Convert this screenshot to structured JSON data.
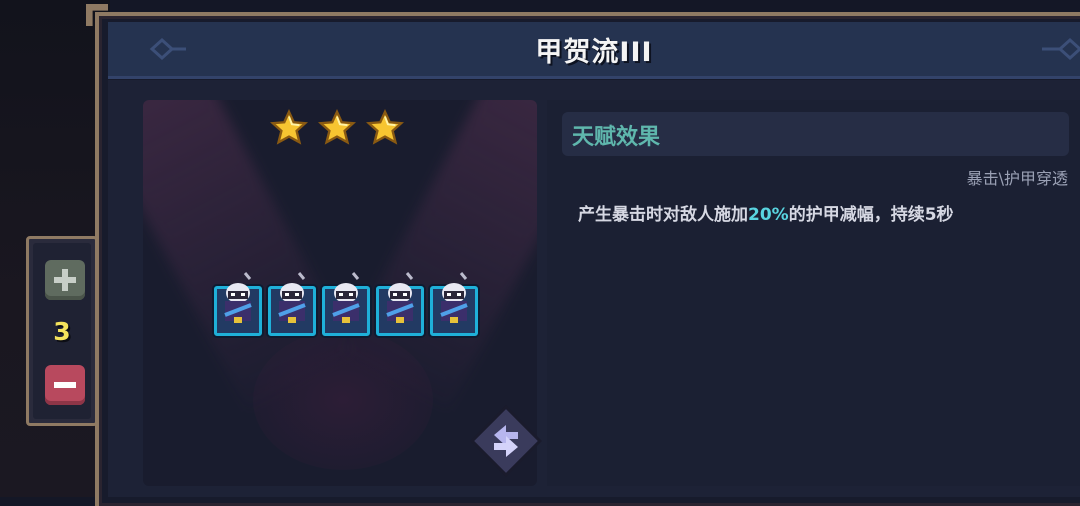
{
  "header": {
    "title": "甲贺流III"
  },
  "rating": {
    "stars": 3,
    "max": 3
  },
  "units": [
    {
      "name": "ninja-unit-1"
    },
    {
      "name": "ninja-unit-2"
    },
    {
      "name": "ninja-unit-3"
    },
    {
      "name": "ninja-unit-4"
    },
    {
      "name": "ninja-unit-5"
    }
  ],
  "counter": {
    "value": "3",
    "plus_icon": "plus-icon",
    "minus_icon": "minus-icon"
  },
  "talent": {
    "heading": "天赋效果",
    "tag": "暴击\\护甲穿透",
    "desc_before": "产生暴击时对敌人施加",
    "desc_highlight": "20%",
    "desc_after": "的护甲减幅，持续5秒"
  },
  "colors": {
    "accent_teal": "#5fb7ad",
    "highlight": "#59d4e0",
    "count_yellow": "#f4e35c",
    "frame_gold": "#8f7a63"
  },
  "icons": [
    "star-icon",
    "swap-icon",
    "plus-icon",
    "minus-icon"
  ]
}
